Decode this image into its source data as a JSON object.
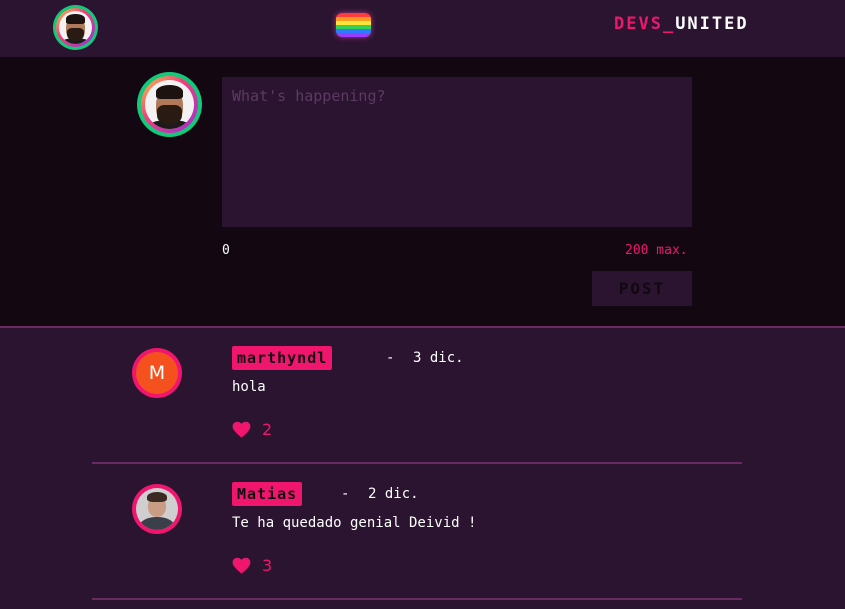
{
  "header": {
    "brand_part1": "DEVS_",
    "brand_part2": "UNITED",
    "logo_icon": "rainbow-flag-icon",
    "avatar_icon": "user-avatar"
  },
  "composer": {
    "placeholder": "What's happening?",
    "value": "",
    "char_count": "0",
    "char_max": "200 max.",
    "post_label": "POST"
  },
  "colors": {
    "accent": "#f0166e",
    "background": "#2b1430",
    "composer_bg": "#130812",
    "online_ring": "#14c97a",
    "divider": "#6b2a5f"
  },
  "posts": [
    {
      "username": "marthyndl",
      "separator": "-",
      "date": "3 dic.",
      "text": "hola",
      "likes": "2",
      "avatar_letter": "M"
    },
    {
      "username": "Matias",
      "separator": "-",
      "date": "2 dic.",
      "text": "Te ha quedado genial Deivid !",
      "likes": "3"
    }
  ]
}
